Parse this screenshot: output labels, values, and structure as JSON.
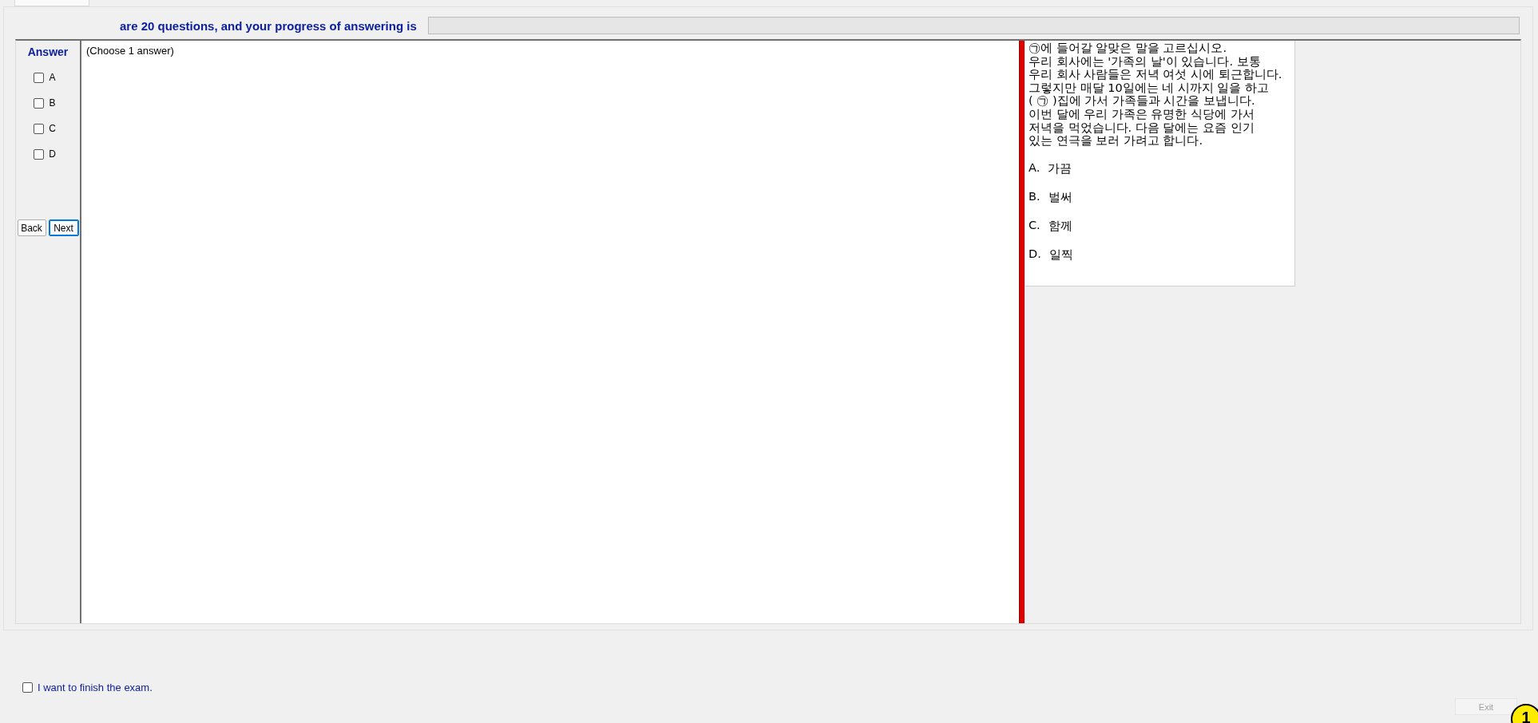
{
  "header": {
    "text": "are 20 questions, and your progress of answering is",
    "progress": {
      "level": 0
    }
  },
  "answer_panel": {
    "title": "Answer",
    "choices": [
      {
        "label": "A",
        "checked": false
      },
      {
        "label": "B",
        "checked": false
      },
      {
        "label": "C",
        "checked": false
      },
      {
        "label": "D",
        "checked": false
      }
    ],
    "buttons": [
      {
        "label": "Back",
        "focused": false
      },
      {
        "label": "Next",
        "focused": true
      }
    ]
  },
  "question": {
    "instruction": "(Choose 1 answer)"
  },
  "passage": {
    "lines": [
      "㉠에 들어갈 알맞은 말을 고르십시오.",
      "우리 회사에는 '가족의 날'이 있습니다. 보통",
      "우리 회사 사람들은 저녁 여섯 시에 퇴근합니다.",
      "그렇지만 매달 10일에는 네 시까지 일을 하고",
      "( ㉠ )집에 가서 가족들과 시간을 보냅니다.",
      "이번 달에 우리 가족은 유명한 식당에 가서",
      "저녁을 먹었습니다. 다음 달에는 요즘 인기",
      "있는 연극을 보러 가려고 합니다."
    ],
    "options": [
      {
        "letter": "A.",
        "text": "가끔"
      },
      {
        "letter": "B.",
        "text": "벌써"
      },
      {
        "letter": "C.",
        "text": "함께"
      },
      {
        "letter": "D.",
        "text": "일찍"
      }
    ]
  },
  "finish": {
    "label": "I want to finish the exam.",
    "checked": false
  },
  "exit_button": {
    "label": "Exit",
    "disabled": true
  },
  "badge": "1"
}
